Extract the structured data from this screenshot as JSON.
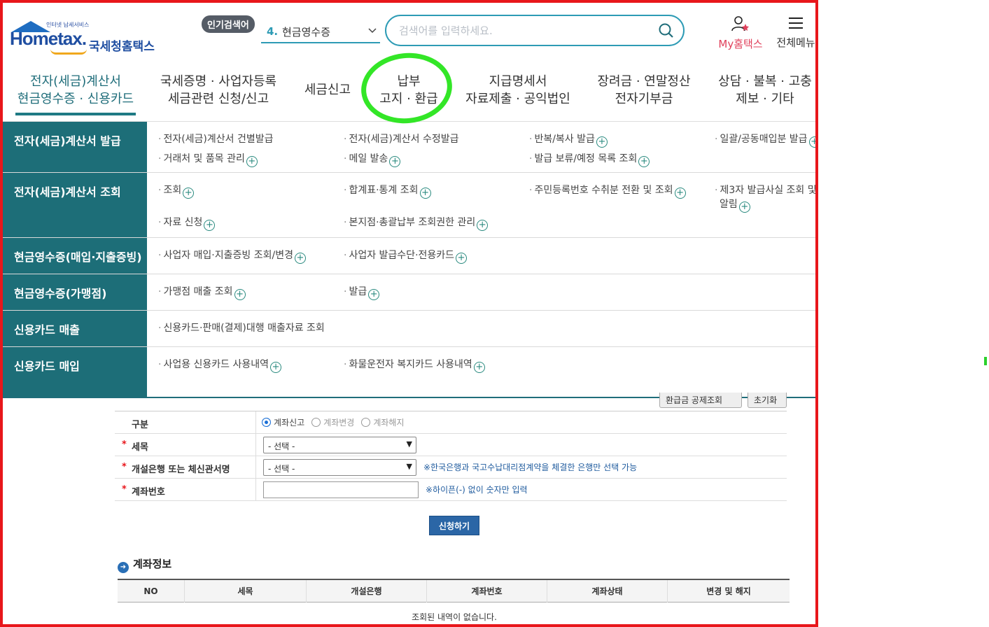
{
  "header": {
    "logo_sub": "인터넷 납세서비스",
    "logo_brand": "Hometax.",
    "logo_korean": "국세청홈택스",
    "popular_badge": "인기검색어",
    "popular_rank_num": "4.",
    "popular_rank_text": "현금영수증",
    "search_placeholder": "검색어를 입력하세요.",
    "my_hometax": "My홈택스",
    "all_menu": "전체메뉴"
  },
  "nav": [
    {
      "line1": "전자(세금)계산서",
      "line2": "현금영수증 · 신용카드"
    },
    {
      "line1": "국세증명 · 사업자등록",
      "line2": "세금관련 신청/신고"
    },
    {
      "line1": "세금신고",
      "line2": ""
    },
    {
      "line1": "납부",
      "line2": "고지 · 환급"
    },
    {
      "line1": "지급명세서",
      "line2": "자료제출 · 공익법인"
    },
    {
      "line1": "장려금 · 연말정산",
      "line2": "전자기부금"
    },
    {
      "line1": "상담 · 불복 · 고충",
      "line2": "제보 · 기타"
    }
  ],
  "mega": {
    "cat1": "전자(세금)계산서 발급",
    "cat1_links": [
      "전자(세금)계산서 건별발급",
      "전자(세금)계산서 수정발급",
      "반복/복사 발급",
      "일괄/공동매입분 발급",
      "거래처 및 품목 관리",
      "메일 발송",
      "발급 보류/예정 목록 조회"
    ],
    "cat2": "전자(세금)계산서 조회",
    "cat2_links": [
      "조회",
      "합계표·통계 조회",
      "주민등록번호 수취분 전환 및 조회",
      "제3자 발급사실 조회 및",
      "알림",
      "자료 신청",
      "본지점·총괄납부 조회권한 관리"
    ],
    "cat3": "현금영수증(매입·지출증빙)",
    "cat3_links": [
      "사업자 매입·지출증빙 조회/변경",
      "사업자 발급수단·전용카드"
    ],
    "cat4": "현금영수증(가맹점)",
    "cat4_links": [
      "가맹점 매출 조회",
      "발급"
    ],
    "cat5": "신용카드 매출",
    "cat5_links": [
      "신용카드·판매(결제)대행 매출자료 조회"
    ],
    "cat6": "신용카드 매입",
    "cat6_links": [
      "사업용 신용카드 사용내역",
      "화물운전자 복지카드 사용내역"
    ]
  },
  "form": {
    "btn_a": "환급금 공제조회",
    "btn_b": "초기화",
    "row1_label": "구분",
    "row1_opts": [
      "계좌신고",
      "계좌변경",
      "계좌해지"
    ],
    "row2_label": "세목",
    "row2_value": "- 선택 -",
    "row3_label": "개설은행 또는 체신관서명",
    "row3_value": "- 선택 -",
    "row3_note": "※한국은행과 국고수납대리점계약을 체결한 은행만 선택 가능",
    "row4_label": "계좌번호",
    "row4_note": "※하이픈(-) 없이 숫자만 입력",
    "required_mark": "*",
    "submit": "신청하기"
  },
  "account": {
    "title": "계좌정보",
    "columns": [
      "NO",
      "세목",
      "개설은행",
      "계좌번호",
      "계좌상태",
      "변경 및 해지"
    ],
    "empty": "조회된 내역이 없습니다."
  },
  "colors": {
    "frame": "#e8161b",
    "accent": "#1d6e78",
    "highlight": "#33e627"
  }
}
